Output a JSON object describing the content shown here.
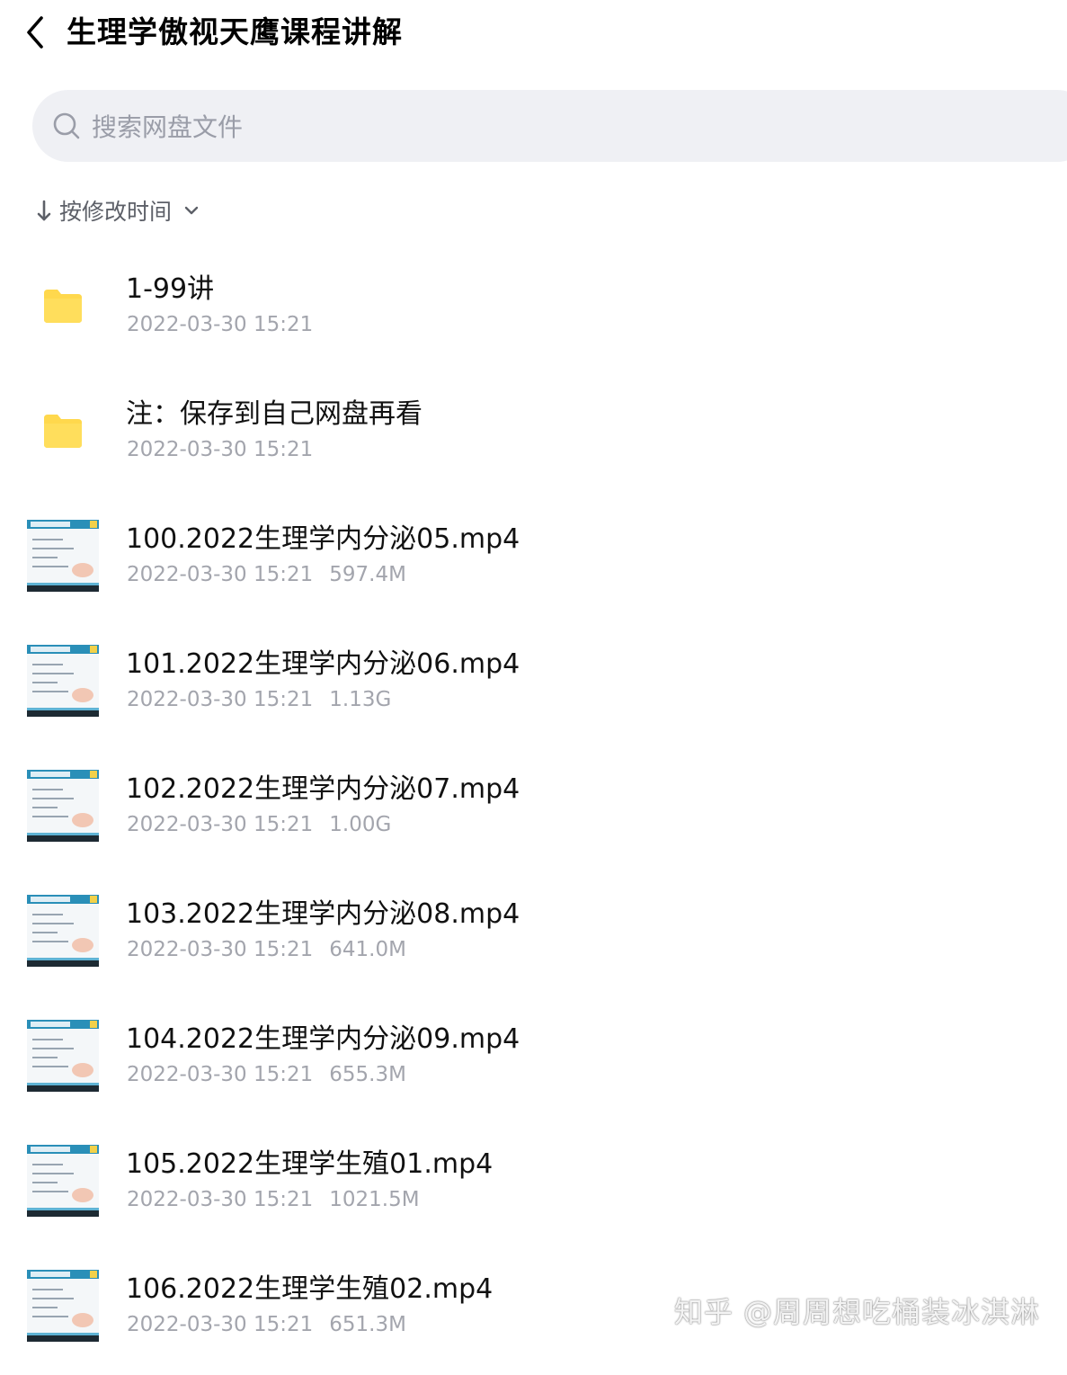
{
  "header": {
    "title": "生理学傲视天鹰课程讲解"
  },
  "search": {
    "placeholder": "搜索网盘文件"
  },
  "sort": {
    "label": "按修改时间"
  },
  "files": [
    {
      "name": "1-99讲",
      "date": "2022-03-30 15:21",
      "size": "",
      "kind": "folder"
    },
    {
      "name": "注：保存到自己网盘再看",
      "date": "2022-03-30 15:21",
      "size": "",
      "kind": "folder"
    },
    {
      "name": "100.2022生理学内分泌05.mp4",
      "date": "2022-03-30 15:21",
      "size": "597.4M",
      "kind": "video"
    },
    {
      "name": "101.2022生理学内分泌06.mp4",
      "date": "2022-03-30 15:21",
      "size": "1.13G",
      "kind": "video"
    },
    {
      "name": "102.2022生理学内分泌07.mp4",
      "date": "2022-03-30 15:21",
      "size": "1.00G",
      "kind": "video"
    },
    {
      "name": "103.2022生理学内分泌08.mp4",
      "date": "2022-03-30 15:21",
      "size": "641.0M",
      "kind": "video"
    },
    {
      "name": "104.2022生理学内分泌09.mp4",
      "date": "2022-03-30 15:21",
      "size": "655.3M",
      "kind": "video"
    },
    {
      "name": "105.2022生理学生殖01.mp4",
      "date": "2022-03-30 15:21",
      "size": "1021.5M",
      "kind": "video"
    },
    {
      "name": "106.2022生理学生殖02.mp4",
      "date": "2022-03-30 15:21",
      "size": "651.3M",
      "kind": "video"
    }
  ],
  "watermark": "知乎 @周周想吃桶装冰淇淋",
  "colors": {
    "folder": "#ffd84d",
    "search_bg": "#eff0f4",
    "meta_text": "#a3a5ad"
  }
}
